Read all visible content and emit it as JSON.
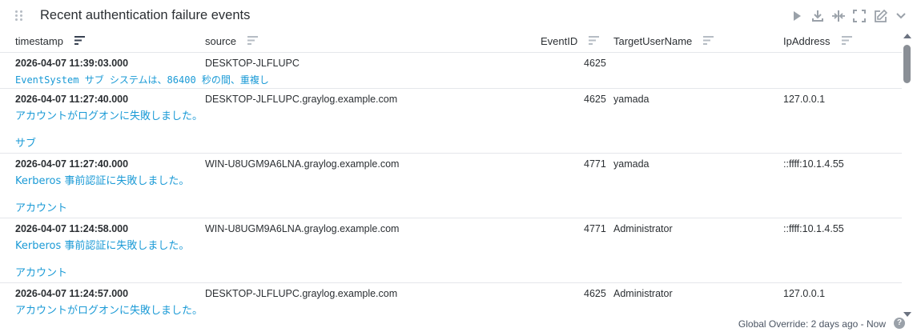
{
  "widget": {
    "title": "Recent authentication failure events",
    "actions": [
      "play-icon",
      "download-icon",
      "split-icon",
      "fullscreen-icon",
      "edit-icon",
      "chevron-down-icon"
    ]
  },
  "table": {
    "columns": [
      {
        "key": "timestamp",
        "label": "timestamp",
        "sorted": true
      },
      {
        "key": "source",
        "label": "source",
        "sorted": false
      },
      {
        "key": "eventid",
        "label": "EventID",
        "sorted": false
      },
      {
        "key": "target",
        "label": "TargetUserName",
        "sorted": false
      },
      {
        "key": "ip",
        "label": "IpAddress",
        "sorted": false
      }
    ],
    "rows": [
      {
        "timestamp": "2026-04-07 11:39:03.000",
        "source": "DESKTOP-JLFLUPC",
        "eventid": "4625",
        "target": "",
        "ip": "",
        "message_lines": [
          "EventSystem サブ システムは、86400 秒の間、重複し"
        ]
      },
      {
        "timestamp": "2026-04-07 11:27:40.000",
        "source": "DESKTOP-JLFLUPC.graylog.example.com",
        "eventid": "4625",
        "target": "yamada",
        "ip": "127.0.0.1",
        "message_lines": [
          "アカウントがログオンに失敗しました。",
          "",
          "サブ"
        ]
      },
      {
        "timestamp": "2026-04-07 11:27:40.000",
        "source": "WIN-U8UGM9A6LNA.graylog.example.com",
        "eventid": "4771",
        "target": "yamada",
        "ip": "::ffff:10.1.4.55",
        "message_lines": [
          "Kerberos 事前認証に失敗しました。",
          "",
          "アカウント"
        ]
      },
      {
        "timestamp": "2026-04-07 11:24:58.000",
        "source": "WIN-U8UGM9A6LNA.graylog.example.com",
        "eventid": "4771",
        "target": "Administrator",
        "ip": "::ffff:10.1.4.55",
        "message_lines": [
          "Kerberos 事前認証に失敗しました。",
          "",
          "アカウント"
        ]
      },
      {
        "timestamp": "2026-04-07 11:24:57.000",
        "source": "DESKTOP-JLFLUPC.graylog.example.com",
        "eventid": "4625",
        "target": "Administrator",
        "ip": "127.0.0.1",
        "message_lines": [
          "アカウントがログオンに失敗しました。"
        ]
      }
    ]
  },
  "footer": {
    "override": "Global Override: 2 days ago - Now",
    "help": "?"
  },
  "colors": {
    "message": "#1a9ad6",
    "divider": "#e4e7eb"
  }
}
